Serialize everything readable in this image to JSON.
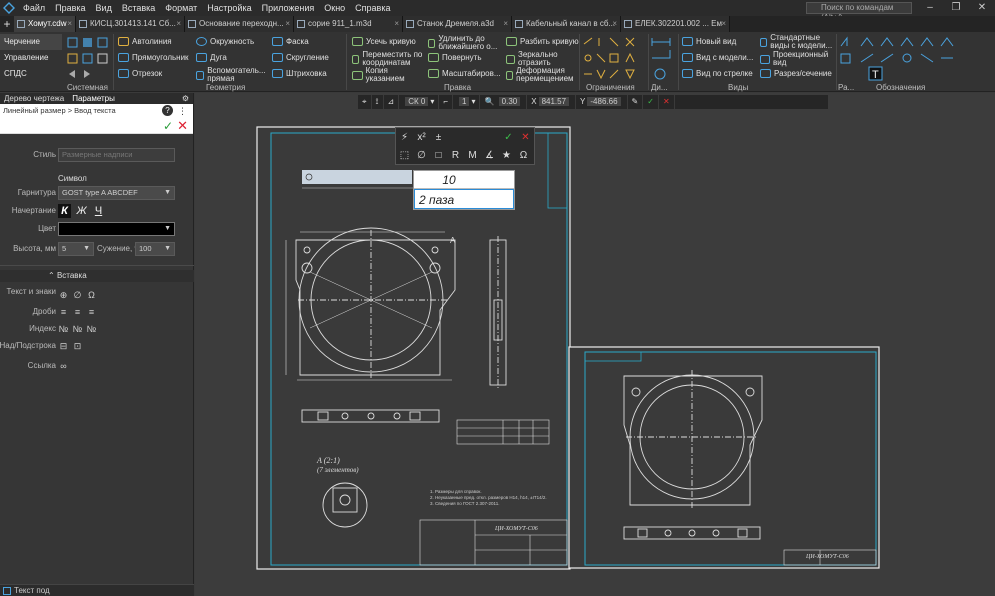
{
  "menubar": {
    "items": [
      "Файл",
      "Правка",
      "Вид",
      "Вставка",
      "Формат",
      "Настройка",
      "Приложения",
      "Окно",
      "Справка"
    ],
    "search_placeholder": "Поиск по командам (Alt+/)"
  },
  "tabs": [
    {
      "label": "Хомут.cdw",
      "active": true
    },
    {
      "label": "КИСЦ.301413.141 Сб...",
      "active": false
    },
    {
      "label": "Основание переходн...",
      "active": false
    },
    {
      "label": "сорие 911_1.m3d",
      "active": false
    },
    {
      "label": "Станок Дремеля.a3d",
      "active": false
    },
    {
      "label": "Кабельный канал в сб...",
      "active": false
    },
    {
      "label": "ЕЛЕК.302201.002 ... Ем",
      "active": false
    }
  ],
  "ribbon": {
    "left_nav": [
      "Черчение",
      "Управление",
      "СПДС"
    ],
    "groups": [
      "Системная",
      "Геометрия",
      "Правка",
      "Ограничения",
      "Ди...",
      "Виды",
      "Ра...",
      "Обозначения"
    ],
    "geometry": [
      "Автолиния",
      "Окружность",
      "Фаска",
      "Прямоугольник",
      "Дуга",
      "Скругление",
      "Отрезок",
      "Вспомогатель... прямая",
      "Штриховка"
    ],
    "edit": [
      "Усечь кривую",
      "Удлинить до ближайшего о...",
      "Разбить кривую",
      "Переместить по координатам",
      "Повернуть",
      "Зеркально отразить",
      "Копия указанием",
      "Масштабиров...",
      "Деформация перемещением"
    ],
    "views": [
      "Новый вид",
      "Стандартные виды с модели...",
      "Вид с модели...",
      "Проекционный вид",
      "Вид по стрелке",
      "Разрез/сечение"
    ]
  },
  "panel": {
    "tabs": [
      "Дерево чертежа",
      "Параметры"
    ],
    "command": "Линейный размер > Ввод текста",
    "style_label": "Стиль",
    "style_value": "Размерные надписи",
    "symbol_section": "Символ",
    "font_label": "Гарнитура",
    "font_value": "GOST type A  ABCDEF",
    "style2_label": "Начертание",
    "bold": "К",
    "italic": "Ж",
    "underline": "Ч",
    "color_label": "Цвет",
    "height_label": "Высота, мм",
    "height_value": "5",
    "width_label": "Сужение, %",
    "width_value": "100",
    "insert_section": "Вставка",
    "insert_rows": [
      "Текст и знаки",
      "Дроби",
      "Индекс",
      "Над/Подстрока",
      "Ссылка"
    ],
    "status": "Текст под"
  },
  "cmdbar": {
    "scale": "СК 0",
    "step": "1",
    "angle": "0.30",
    "x_label": "X",
    "x_value": "841.57",
    "y_label": "Y",
    "y_value": "-486.66"
  },
  "text_edit": {
    "line1": "10",
    "line2": "2 паза"
  },
  "drawing": {
    "title_main": "ЦИ-ХОМУТ-С06",
    "title_second": "ЦИ-ХОМУТ-С06",
    "detail_label": "A (2:1)",
    "detail_caption": "(7 элементов)",
    "notes": [
      "1. Размеры для справок.",
      "2. Неуказанные пред. откл. размеров H14, h14, ±IT14/2.",
      "3. Сведения по ГОСТ 2.307-2011."
    ]
  }
}
